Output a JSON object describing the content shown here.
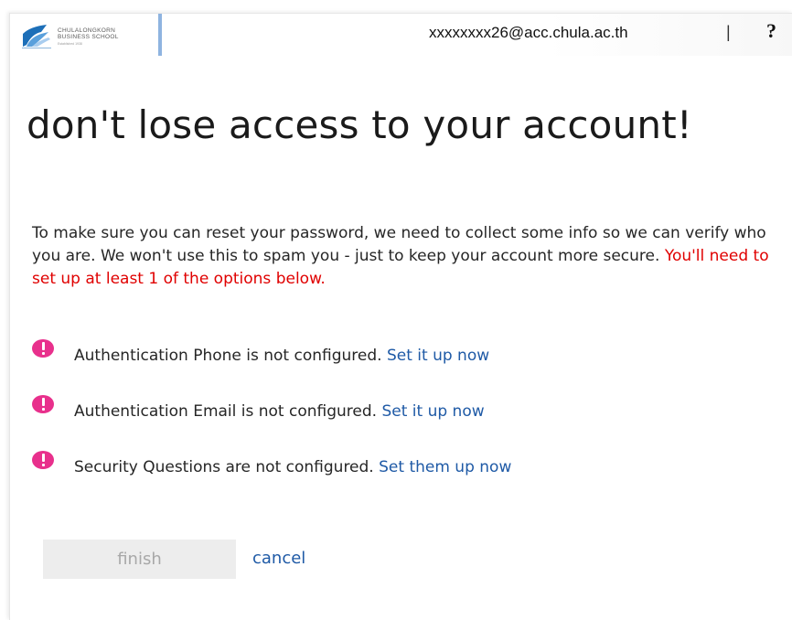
{
  "header": {
    "logo": {
      "line1": "CHULALONGKORN",
      "line2": "BUSINESS SCHOOL",
      "tagline": "Established 1938",
      "icon": "chula-logo-icon"
    },
    "user_email": "xxxxxxxx26@acc.chula.ac.th",
    "separator": "|",
    "help_symbol": "?"
  },
  "page": {
    "title": "don't lose access to your account!",
    "intro_text": "To make sure you can reset your password, we need to collect some info so we can verify who you are. We won't use this to spam you - just to keep your account more secure.",
    "intro_warning": "You'll need to set up at least 1 of the options below."
  },
  "status_items": [
    {
      "icon": "exclamation-icon",
      "text": "Authentication Phone is not configured.",
      "link": "Set it up now"
    },
    {
      "icon": "exclamation-icon",
      "text": "Authentication Email is not configured.",
      "link": "Set it up now"
    },
    {
      "icon": "exclamation-icon",
      "text": "Security Questions are not configured.",
      "link": "Set them up now"
    }
  ],
  "actions": {
    "finish_label": "finish",
    "cancel_label": "cancel"
  },
  "colors": {
    "alert_icon": "#e8308c",
    "warning_text": "#e00000",
    "link": "#1f5aa6",
    "header_divider": "#8fb4e0",
    "disabled_button_bg": "#ededed",
    "disabled_button_text": "#a8a8a8"
  }
}
